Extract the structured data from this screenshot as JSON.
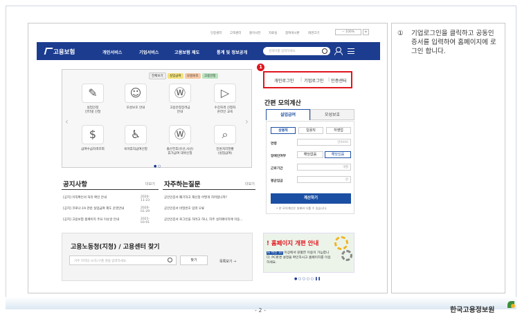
{
  "utility": {
    "links": [
      "인증센터",
      "고객센터",
      "홈이사전",
      "자료실",
      "참여게시판",
      "화면크기"
    ],
    "zoom": "100%",
    "zoom_plus": "+"
  },
  "nav": {
    "logo": "고용보험",
    "items": [
      "개인서비스",
      "기업서비스",
      "고용보험 제도",
      "통계 및 정보공개"
    ],
    "search_placeholder": "검색어를 입력하세요."
  },
  "services": {
    "chips": [
      "전체보기",
      "실업급여",
      "모성보호",
      "고용안정"
    ],
    "tiles": [
      {
        "label": "실업인정\n인터넷 신청",
        "icon": "pencil-icon"
      },
      {
        "label": "모성보호 안내",
        "icon": "baby-icon"
      },
      {
        "label": "고용안정장려금\n안내",
        "icon": "coin-hand-icon"
      },
      {
        "label": "수강자격 신청자\n온라인 교육",
        "icon": "play-icon"
      },
      {
        "label": "급여수급자격조회",
        "icon": "coins-icon"
      },
      {
        "label": "육아휴직급여신청",
        "icon": "stroller-icon"
      },
      {
        "label": "출산전후(유산,사산)\n휴가급여 대위신청",
        "icon": "money-bag-icon"
      },
      {
        "label": "민원처리현황\n(실업급여)",
        "icon": "document-search-icon"
      }
    ],
    "pager": "● ○"
  },
  "login": {
    "badge": "1",
    "personal": "개인로그인",
    "corporate": "기업로그인",
    "cert": "인증센터"
  },
  "calc": {
    "title": "간편 모의계산",
    "tabs": [
      "실업급여",
      "모성보호"
    ],
    "segments": [
      "상용직",
      "일용직",
      "자영업"
    ],
    "rows": [
      {
        "label": "연령",
        "placeholder": "만0000"
      },
      {
        "label": "장애인여부",
        "options": [
          "해당없음",
          "해당있음"
        ]
      },
      {
        "label": "근로기간",
        "placeholder": "개월"
      },
      {
        "label": "평균임금",
        "placeholder": "원"
      }
    ],
    "button": "계산하기",
    "note": "• 본 모의계산은 실제와 다를 수 있습니다."
  },
  "notices": {
    "title": "공지사항",
    "more": "더보기",
    "items": [
      {
        "text": "[공지] 이직확인서 처리 확인 안내",
        "date": "2020-11-23"
      },
      {
        "text": "[공지] 코로나-19 관련 실업급여 제도 운영안내",
        "date": "2020-01-29"
      },
      {
        "text": "[공지] 고용보험 홈페이지 주요 이슈알 안내",
        "date": "2021-03-01"
      }
    ]
  },
  "faq": {
    "title": "자주하는질문",
    "more": "더보기",
    "items": [
      "공인인증서 폐기하고 재신청 어떻게 하려합니까?",
      "공인인증서 비밀번호 입력 오류",
      "공인인증서 로그인을 하려고 하니, 자주 설치페이지에 이동..."
    ]
  },
  "finder": {
    "title": "고용노동청(지청) / 고용센터 찾기",
    "placeholder": "거주 지역의 시/도/구를 명을 입력하세요.",
    "button": "찾기",
    "list_link": "목록보기 →"
  },
  "banner": {
    "title": "! 홈페이지 개편 안내",
    "browser": "IE 버전 10",
    "text": "이상에서 원활한 이용이 가능합니다. PC환경 설정을 확인하시고 홈페이지를 이용하세요.",
    "pager": "● ○ ○ ○ ○ ❚❚"
  },
  "instruction": {
    "num": "①",
    "text": "기업로그인을 클릭하고 공동인증서를 입력하여 홈페이지에 로그인 합니다."
  },
  "footer": {
    "page": "- 2 -",
    "brand": "한국고용정보원"
  },
  "colors": {
    "nav": "#1b3c8f",
    "highlight": "#e1141c",
    "button": "#1b4fa3"
  }
}
